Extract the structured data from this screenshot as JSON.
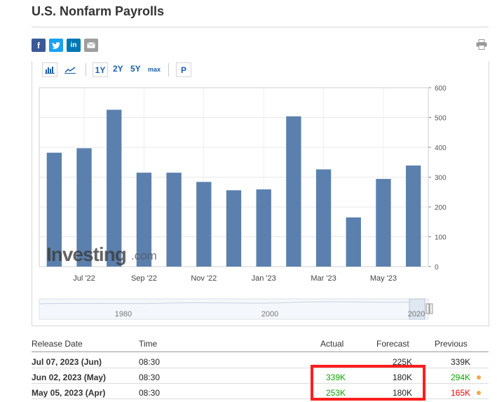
{
  "page": {
    "title": "U.S. Nonfarm Payrolls"
  },
  "toolbar": {
    "ranges": [
      "1Y",
      "2Y",
      "5Y"
    ],
    "max_label": "max",
    "p_label": "P"
  },
  "brand": {
    "word": "Investing",
    "suffix": ".com"
  },
  "navigator": {
    "labels": [
      "1980",
      "2000",
      "2020"
    ]
  },
  "chart_data": {
    "type": "bar",
    "categories": [
      "Jun '22",
      "Jul '22",
      "Aug '22",
      "Sep '22",
      "Oct '22",
      "Nov '22",
      "Dec '22",
      "Jan '23",
      "Feb '23",
      "Mar '23",
      "Apr '23",
      "May '23",
      "Jun '23"
    ],
    "values": [
      382,
      397,
      526,
      315,
      315,
      284,
      256,
      259,
      504,
      326,
      165,
      294,
      339
    ],
    "x_tick_labels": [
      "Jul '22",
      "Sep '22",
      "Nov '22",
      "Jan '23",
      "Mar '23",
      "May '23"
    ],
    "y_ticks": [
      0,
      100,
      200,
      300,
      400,
      500,
      600
    ],
    "ylim": [
      0,
      600
    ],
    "bar_color": "#5b80ad",
    "y_axis_side": "right",
    "grid": true
  },
  "table": {
    "headers": {
      "release_date": "Release Date",
      "time": "Time",
      "actual": "Actual",
      "forecast": "Forecast",
      "previous": "Previous"
    },
    "rows": [
      {
        "date": "Jul 07, 2023 (Jun)",
        "time": "08:30",
        "actual": "",
        "forecast": "225K",
        "previous": "339K",
        "actual_color": "",
        "previous_color": "#222222",
        "dot": false
      },
      {
        "date": "Jun 02, 2023 (May)",
        "time": "08:30",
        "actual": "339K",
        "forecast": "180K",
        "previous": "294K",
        "actual_color": "#0ea600",
        "previous_color": "#0ea600",
        "dot": true
      },
      {
        "date": "May 05, 2023 (Apr)",
        "time": "08:30",
        "actual": "253K",
        "forecast": "180K",
        "previous": "165K",
        "actual_color": "#0ea600",
        "previous_color": "#ff0000",
        "dot": true
      }
    ]
  }
}
